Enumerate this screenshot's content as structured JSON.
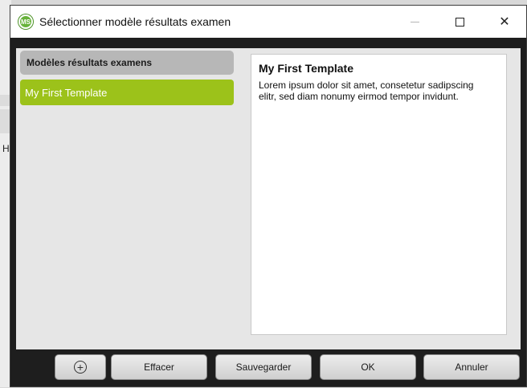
{
  "window": {
    "title": "Sélectionner modèle résultats examen",
    "app_icon": "ms-logo-icon",
    "app_icon_text": "MS",
    "close_glyph": "✕"
  },
  "background": {
    "letter": "H"
  },
  "templates_list": {
    "header": "Modèles résultats examens",
    "items": [
      {
        "label": "My First Template",
        "selected": true
      }
    ]
  },
  "detail": {
    "title": "My First Template",
    "body": "Lorem ipsum dolor sit amet, consetetur sadipscing elitr, sed diam nonumy eirmod tempor invidunt."
  },
  "footer": {
    "add_icon": "plus-circle-icon",
    "add_glyph": "+",
    "delete_label": "Effacer",
    "save_label": "Sauvegarder",
    "ok_label": "OK",
    "cancel_label": "Annuler"
  },
  "colors": {
    "accent_selected": "#9cc21a",
    "header_bg": "#b7b7b7",
    "frame": "#1e1e1e"
  }
}
